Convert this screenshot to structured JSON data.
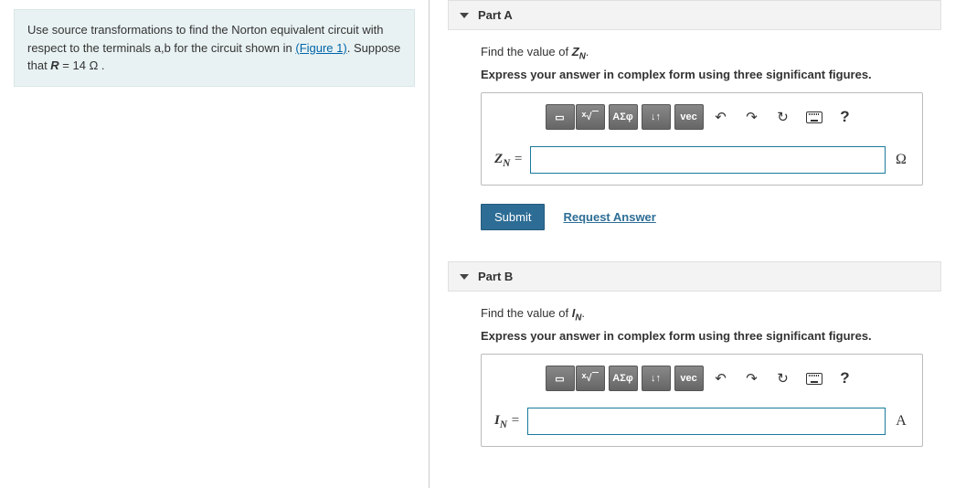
{
  "left": {
    "prompt_pre": "Use source transformations to find the Norton equivalent circuit with respect to the terminals a,b for the circuit shown in ",
    "figure_link": "(Figure 1)",
    "prompt_post": ". Suppose that ",
    "var": "R",
    "eq": " = 14 ",
    "unit": "Ω",
    "period": " ."
  },
  "toolbar": {
    "templates": "▭",
    "radical": "√",
    "greek": "ΑΣφ",
    "updown": "↓↑",
    "vec": "vec",
    "undo": "↶",
    "redo": "↷",
    "reset": "↻",
    "help": "?"
  },
  "partA": {
    "header": "Part A",
    "question_pre": "Find the value of ",
    "var_html": "Z",
    "var_sub": "N",
    "question_post": ".",
    "instruction": "Express your answer in complex form using three significant figures.",
    "label_pre": "Z",
    "label_sub": "N",
    "label_eq": " = ",
    "unit": "Ω",
    "submit": "Submit",
    "request": "Request Answer"
  },
  "partB": {
    "header": "Part B",
    "question_pre": "Find the value of ",
    "var_html": "I",
    "var_sub": "N",
    "question_post": ".",
    "instruction": "Express your answer in complex form using three significant figures.",
    "label_pre": "I",
    "label_sub": "N",
    "label_eq": " = ",
    "unit": "A"
  }
}
